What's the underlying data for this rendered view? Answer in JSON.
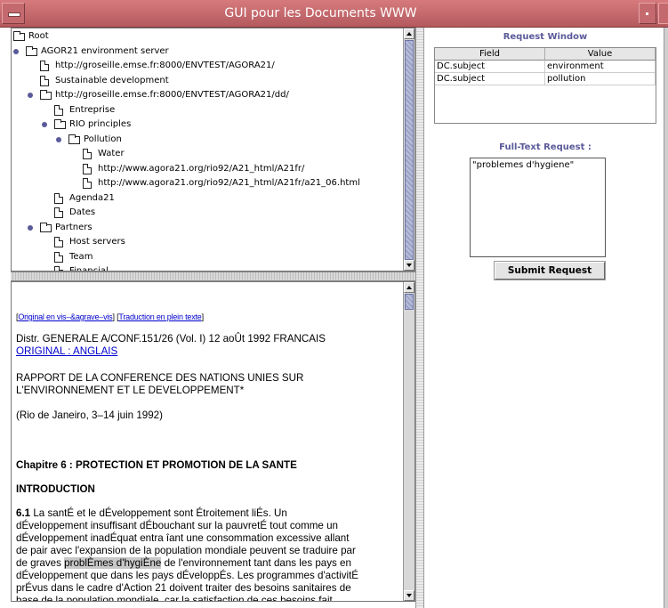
{
  "window": {
    "title": "GUI pour les Documents WWW"
  },
  "tree": {
    "items": [
      {
        "label": "Root",
        "icon": "folder-icon",
        "bullet": false,
        "indent": 0
      },
      {
        "label": "AGOR21 environment server",
        "icon": "folder-icon",
        "bullet": true,
        "indent": 0
      },
      {
        "label": "http://groseille.emse.fr:8000/ENVTEST/AGORA21/",
        "icon": "document-icon",
        "bullet": false,
        "indent": 1
      },
      {
        "label": "Sustainable development",
        "icon": "document-icon",
        "bullet": false,
        "indent": 1
      },
      {
        "label": "http://groseille.emse.fr:8000/ENVTEST/AGORA21/dd/",
        "icon": "folder-icon",
        "bullet": true,
        "indent": 1
      },
      {
        "label": "Entreprise",
        "icon": "document-icon",
        "bullet": false,
        "indent": 2
      },
      {
        "label": "RIO principles",
        "icon": "folder-icon",
        "bullet": true,
        "indent": 2
      },
      {
        "label": "Pollution",
        "icon": "folder-icon",
        "bullet": true,
        "indent": 3
      },
      {
        "label": "Water",
        "icon": "document-icon",
        "bullet": false,
        "indent": 4
      },
      {
        "label": "http://www.agora21.org/rio92/A21_html/A21fr/",
        "icon": "document-icon",
        "bullet": false,
        "indent": 4
      },
      {
        "label": "http://www.agora21.org/rio92/A21_html/A21fr/a21_06.html",
        "icon": "document-icon",
        "bullet": false,
        "indent": 4
      },
      {
        "label": "Agenda21",
        "icon": "document-icon",
        "bullet": false,
        "indent": 2
      },
      {
        "label": "Dates",
        "icon": "document-icon",
        "bullet": false,
        "indent": 2
      },
      {
        "label": "Partners",
        "icon": "folder-icon",
        "bullet": true,
        "indent": 1
      },
      {
        "label": "Host servers",
        "icon": "document-icon",
        "bullet": false,
        "indent": 2
      },
      {
        "label": "Team",
        "icon": "document-icon",
        "bullet": false,
        "indent": 2
      },
      {
        "label": "Financial",
        "icon": "document-icon",
        "bullet": false,
        "indent": 2
      }
    ]
  },
  "document": {
    "link_original": "Original en vis–&agrave–vis",
    "link_translation": "Traduction en plein texte",
    "distr_line": "Distr. GENERALE A/CONF.151/26 (Vol. I) 12 aoÛt 1992 FRANCAIS",
    "original_link": "ORIGINAL : ANGLAIS",
    "rapport_line1": "RAPPORT DE LA CONFERENCE DES NATIONS UNIES SUR",
    "rapport_line2": "L'ENVIRONNEMENT ET LE DEVELOPPEMENT*",
    "place_line": "(Rio de Janeiro, 3–14 juin 1992)",
    "chapter_heading": "Chapitre 6 : PROTECTION ET PROMOTION DE LA SANTE",
    "intro_heading": "INTRODUCTION",
    "para_number": "6.1",
    "para_line1": " La santÉ et le dÉveloppement sont Étroitement liÉs. Un",
    "para_line2": "dÉveloppement insuffisant dÉbouchant sur la pauvretÉ tout comme un",
    "para_line3": "dÉveloppement inadÉquat entra îant une consommation excessive allant",
    "para_line4": "de pair avec l'expansion de la population mondiale peuvent se traduire par",
    "para_line5_pre": "de graves ",
    "para_line5_hl": "problÈmes d'hygiÈne",
    "para_line5_post": " de l'environnement tant dans les pays en",
    "para_line6": "dÉveloppement que dans les pays dÉveloppÉs. Les programmes d'activitÉ",
    "para_line7": "prÉvus dans le cadre d'Action 21 doivent traiter des besoins sanitaires de",
    "para_line8": "base de la population mondiale, car la satisfaction de ces besoins fait"
  },
  "request": {
    "title": "Request Window",
    "columns": [
      "Field",
      "Value"
    ],
    "rows": [
      {
        "field": "DC.subject",
        "value": "environment"
      },
      {
        "field": "DC.subject",
        "value": "pollution"
      }
    ]
  },
  "fulltext": {
    "title": "Full-Text Request :",
    "value": "\"problemes d'hygiene\"",
    "submit_label": "Submit Request"
  },
  "colors": {
    "titlebar": "#c46a6e",
    "accent_label": "#5a5a9a",
    "link": "#0000cc",
    "scroll_thumb": "#9aa2c8"
  }
}
